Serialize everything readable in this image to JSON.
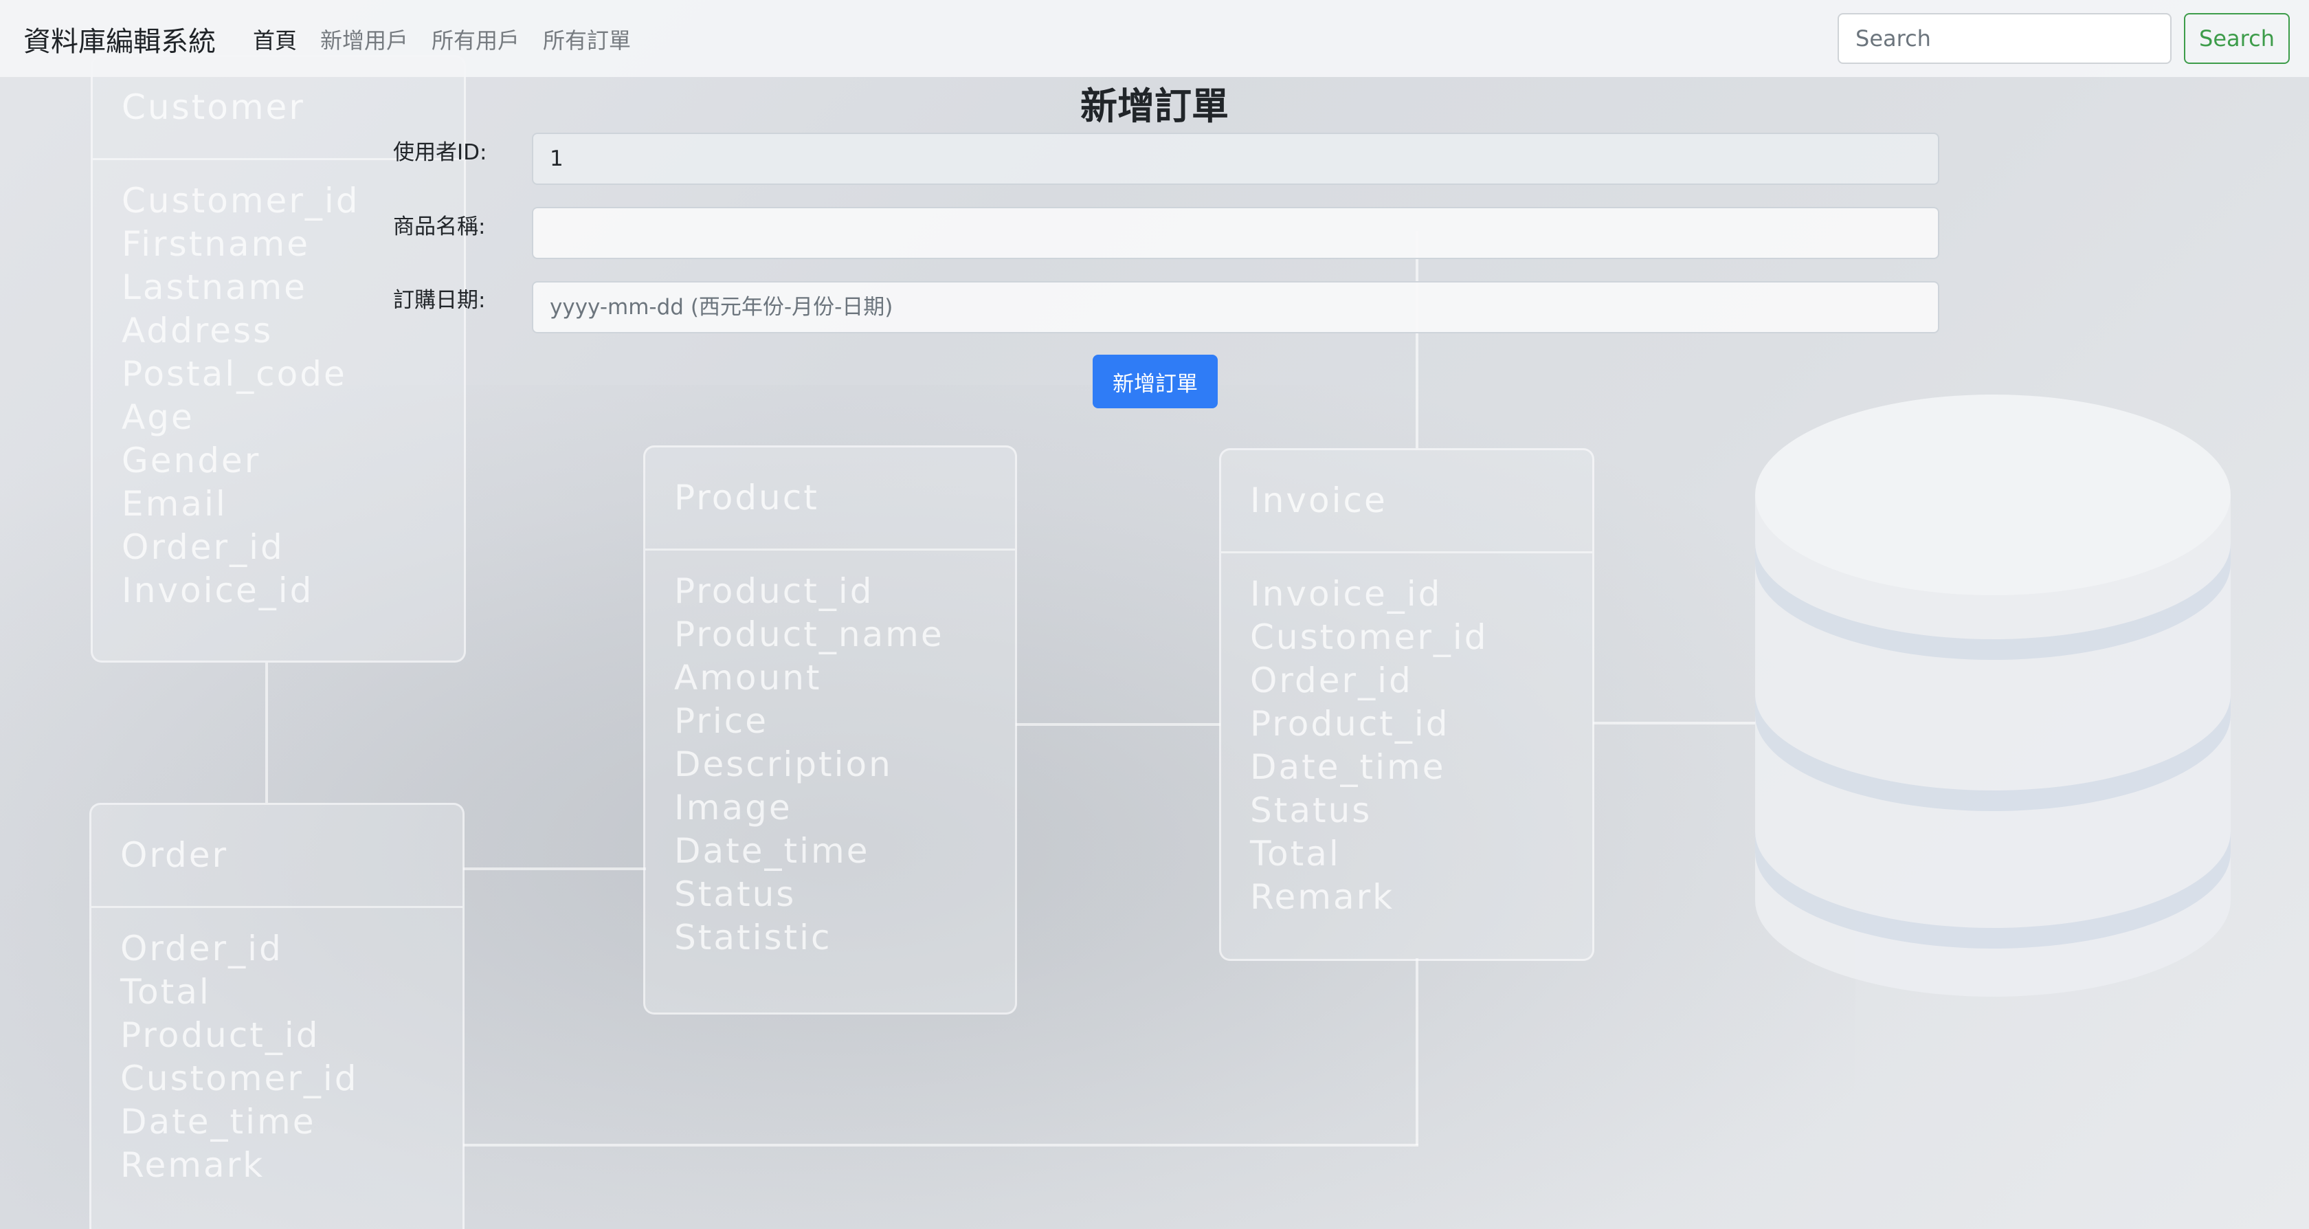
{
  "navbar": {
    "brand": "資料庫編輯系統",
    "links": [
      {
        "label": "首頁",
        "active": true
      },
      {
        "label": "新增用戶",
        "active": false
      },
      {
        "label": "所有用戶",
        "active": false
      },
      {
        "label": "所有訂單",
        "active": false
      }
    ],
    "search_placeholder": "Search",
    "search_button": "Search"
  },
  "form": {
    "title": "新增訂單",
    "fields": [
      {
        "label": "使用者ID:",
        "value": "1",
        "placeholder": ""
      },
      {
        "label": "商品名稱:",
        "value": "",
        "placeholder": ""
      },
      {
        "label": "訂購日期:",
        "value": "",
        "placeholder": "yyyy-mm-dd (西元年份-月份-日期)"
      }
    ],
    "submit_label": "新增訂單"
  },
  "background": {
    "tables": [
      {
        "title": "Customer",
        "fields": [
          "Customer_id",
          "Firstname",
          "Lastname",
          "Address",
          "Postal_code",
          "Age",
          "Gender",
          "Email",
          "Order_id",
          "Invoice_id"
        ]
      },
      {
        "title": "Order",
        "fields": [
          "Order_id",
          "Total",
          "Product_id",
          "Customer_id",
          "Date_time",
          "Remark"
        ]
      },
      {
        "title": "Product",
        "fields": [
          "Product_id",
          "Product_name",
          "Amount",
          "Price",
          "Description",
          "Image",
          "Date_time",
          "Status",
          "Statistic"
        ]
      },
      {
        "title": "Invoice",
        "fields": [
          "Invoice_id",
          "Customer_id",
          "Order_id",
          "Product_id",
          "Date_time",
          "Status",
          "Total",
          "Remark"
        ]
      }
    ]
  },
  "colors": {
    "primary": "#2f7cf6",
    "success": "#3d9c4a",
    "navbar_bg": "#f3f4f6",
    "text": "#212529",
    "muted": "#767b80"
  }
}
